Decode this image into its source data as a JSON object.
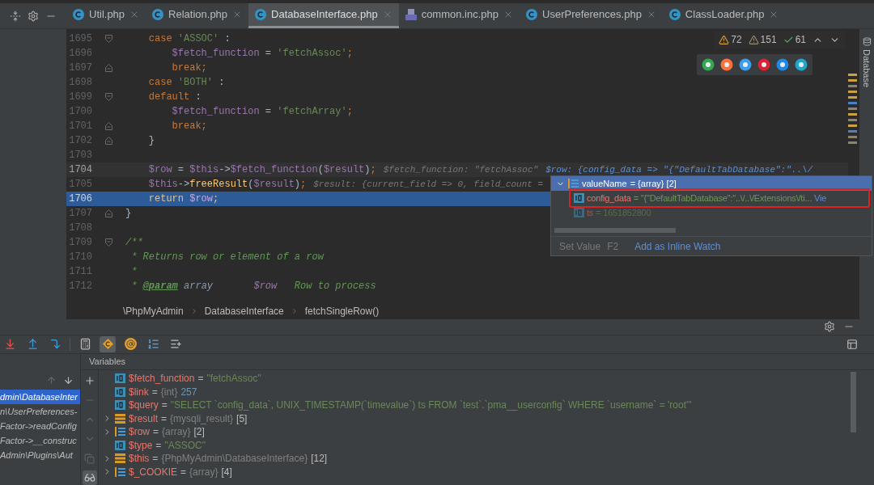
{
  "tabs": [
    {
      "label": "Util.php",
      "kind": "class",
      "selected": false
    },
    {
      "label": "Relation.php",
      "kind": "class",
      "selected": false
    },
    {
      "label": "DatabaseInterface.php",
      "kind": "class",
      "selected": true
    },
    {
      "label": "common.inc.php",
      "kind": "php",
      "selected": false
    },
    {
      "label": "UserPreferences.php",
      "kind": "class",
      "selected": false
    },
    {
      "label": "ClassLoader.php",
      "kind": "class",
      "selected": false
    }
  ],
  "inspections": [
    {
      "kind": "error",
      "count": "72"
    },
    {
      "kind": "warning",
      "count": "151"
    },
    {
      "kind": "ok",
      "count": "61"
    }
  ],
  "browsers": [
    {
      "color": "#34a853"
    },
    {
      "color": "#ff7139"
    },
    {
      "color": "#3b9cf0"
    },
    {
      "color": "#e0202e"
    },
    {
      "color": "#1e88e5"
    },
    {
      "color": "#1fa7c9"
    }
  ],
  "code_lines": [
    {
      "number": "1695",
      "kind": "fold-start",
      "current": false,
      "execution": false,
      "tokens": [
        {
          "kind": "kw",
          "text": "    case "
        },
        {
          "kind": "str",
          "text": "'ASSOC'"
        },
        {
          "kind": "plain",
          "text": " :"
        }
      ]
    },
    {
      "number": "1696",
      "kind": "plain",
      "current": false,
      "execution": false,
      "tokens": [
        {
          "kind": "var",
          "text": "        $fetch_function"
        },
        {
          "kind": "plain",
          "text": " = "
        },
        {
          "kind": "str",
          "text": "'fetchAssoc'"
        },
        {
          "kind": "kw",
          "text": ";"
        }
      ]
    },
    {
      "number": "1697",
      "kind": "fold-end",
      "current": false,
      "execution": false,
      "tokens": [
        {
          "kind": "kw",
          "text": "        break;"
        }
      ]
    },
    {
      "number": "1698",
      "kind": "plain",
      "current": false,
      "execution": false,
      "tokens": [
        {
          "kind": "kw",
          "text": "    case "
        },
        {
          "kind": "str",
          "text": "'BOTH'"
        },
        {
          "kind": "plain",
          "text": " :"
        }
      ]
    },
    {
      "number": "1699",
      "kind": "fold-start",
      "current": false,
      "execution": false,
      "tokens": [
        {
          "kind": "kw",
          "text": "    default"
        },
        {
          "kind": "plain",
          "text": " :"
        }
      ]
    },
    {
      "number": "1700",
      "kind": "plain",
      "current": false,
      "execution": false,
      "tokens": [
        {
          "kind": "var",
          "text": "        $fetch_function"
        },
        {
          "kind": "plain",
          "text": " = "
        },
        {
          "kind": "str",
          "text": "'fetchArray'"
        },
        {
          "kind": "kw",
          "text": ";"
        }
      ]
    },
    {
      "number": "1701",
      "kind": "fold-end",
      "current": false,
      "execution": false,
      "tokens": [
        {
          "kind": "kw",
          "text": "        break;"
        }
      ]
    },
    {
      "number": "1702",
      "kind": "fold-end",
      "current": false,
      "execution": false,
      "tokens": [
        {
          "kind": "plain",
          "text": "    }"
        }
      ]
    },
    {
      "number": "1703",
      "kind": "plain",
      "current": false,
      "execution": false
    },
    {
      "number": "1704",
      "kind": "plain",
      "current": true,
      "execution": false,
      "tokens": [
        {
          "kind": "var",
          "text": "    $row"
        },
        {
          "kind": "plain",
          "text": " = "
        },
        {
          "kind": "var",
          "text": "$this"
        },
        {
          "kind": "plain",
          "text": "->"
        },
        {
          "kind": "var",
          "text": "$fetch_function"
        },
        {
          "kind": "plain",
          "text": "("
        },
        {
          "kind": "var",
          "text": "$result"
        },
        {
          "kind": "plain",
          "text": ")"
        },
        {
          "kind": "kw",
          "text": ";"
        }
      ],
      "hints": [
        {
          "kind": "plain",
          "text": "$fetch_function: \"fetchAssoc\""
        },
        {
          "kind": "changed",
          "text": "$row: {config_data => \"{\"DefaultTabDatabase\":\"..\\/"
        }
      ]
    },
    {
      "number": "1705",
      "kind": "plain",
      "current": false,
      "execution": false,
      "tokens": [
        {
          "kind": "var",
          "text": "    $this"
        },
        {
          "kind": "plain",
          "text": "->"
        },
        {
          "kind": "fn",
          "text": "freeResult"
        },
        {
          "kind": "plain",
          "text": "("
        },
        {
          "kind": "var",
          "text": "$result"
        },
        {
          "kind": "plain",
          "text": ")"
        },
        {
          "kind": "kw",
          "text": ";"
        }
      ],
      "hints": [
        {
          "kind": "plain",
          "text": "$result: {current_field => 0, field_count ="
        }
      ]
    },
    {
      "number": "1706",
      "kind": "plain",
      "current": false,
      "execution": true,
      "tokens": [
        {
          "kind": "kw",
          "text": "    return "
        },
        {
          "kind": "var",
          "text": "$row"
        },
        {
          "kind": "kw",
          "text": ";"
        }
      ]
    },
    {
      "number": "1707",
      "kind": "fold-end",
      "current": false,
      "execution": false,
      "tokens": [
        {
          "kind": "plain",
          "text": "}"
        }
      ]
    },
    {
      "number": "1708",
      "kind": "plain",
      "current": false,
      "execution": false
    },
    {
      "number": "1709",
      "kind": "fold-start",
      "current": false,
      "execution": false,
      "tokens": [
        {
          "kind": "comment",
          "text": "/**"
        }
      ]
    },
    {
      "number": "1710",
      "kind": "plain",
      "current": false,
      "execution": false,
      "tokens": [
        {
          "kind": "comment",
          "text": " * Returns row or element of a row"
        }
      ]
    },
    {
      "number": "1711",
      "kind": "plain",
      "current": false,
      "execution": false,
      "tokens": [
        {
          "kind": "comment",
          "text": " *"
        }
      ]
    },
    {
      "number": "1712",
      "kind": "plain",
      "current": false,
      "execution": false,
      "tokens": [
        {
          "kind": "comment",
          "text": " * "
        },
        {
          "kind": "doctag",
          "text": "@param"
        },
        {
          "kind": "docplain",
          "text": " array       "
        },
        {
          "kind": "docvar",
          "text": "$row"
        },
        {
          "kind": "comment",
          "text": "   Row to process"
        }
      ]
    }
  ],
  "value_popup": {
    "root": {
      "name": "valueName",
      "value": "= {array} [2]",
      "expanded": true,
      "selected": true
    },
    "children": [
      {
        "name": "config_data",
        "value": "= \"{\"DefaultTabDatabase\":\"..\\/..\\/Extensions\\/ti...",
        "link": "Vie",
        "annotated": true,
        "dim": false
      },
      {
        "name": "ts",
        "value": "= 1651852800",
        "annotated": false,
        "dim": true
      }
    ],
    "actions": [
      {
        "kind": "plain",
        "label": "Set Value",
        "shortcut": "F2"
      },
      {
        "kind": "link",
        "label": "Add as Inline Watch"
      }
    ]
  },
  "breadcrumb": [
    "\\PhpMyAdmin",
    "DatabaseInterface",
    "fetchSingleRow()"
  ],
  "debug": {
    "toolbar": [
      {
        "kind": "step-into",
        "selected": false
      },
      {
        "kind": "step-out",
        "selected": false
      },
      {
        "kind": "run-to-cursor",
        "selected": false
      },
      {
        "kind": "evaluate",
        "selected": false
      },
      {
        "kind": "class-filter",
        "selected": true
      },
      {
        "kind": "at",
        "selected": false
      },
      {
        "kind": "numbered-list",
        "selected": false
      },
      {
        "kind": "add-list",
        "selected": false
      }
    ],
    "frames": [
      {
        "text": "dmin\\DatabaseInter",
        "selected": true
      },
      {
        "text": "n\\UserPreferences-",
        "selected": false
      },
      {
        "text": "Factor->readConfig",
        "selected": false
      },
      {
        "text": "Factor->__construc",
        "selected": false
      },
      {
        "text": "Admin\\Plugins\\Aut",
        "selected": false
      }
    ],
    "variables_title": "Variables",
    "side_tools": [
      {
        "kind": "add",
        "disabled": false,
        "selected": false
      },
      {
        "kind": "remove",
        "disabled": true,
        "selected": false
      },
      {
        "kind": "up",
        "disabled": true,
        "selected": false
      },
      {
        "kind": "down",
        "disabled": true,
        "selected": false
      },
      {
        "kind": "copy",
        "disabled": true,
        "selected": false
      },
      {
        "kind": "watch",
        "disabled": false,
        "selected": true
      }
    ],
    "variables": [
      {
        "kind": "primitive",
        "expandable": false,
        "name": "$fetch_function",
        "separator": "=",
        "value": {
          "kind": "string",
          "text": "\"fetchAssoc\""
        }
      },
      {
        "kind": "primitive",
        "expandable": false,
        "name": "$link",
        "separator": "=",
        "type": "{int}",
        "value": {
          "kind": "number",
          "text": "257"
        }
      },
      {
        "kind": "primitive",
        "expandable": false,
        "name": "$query",
        "separator": "=",
        "value": {
          "kind": "string",
          "text": "\"SELECT `config_data`, UNIX_TIMESTAMP(`timevalue`) ts FROM `test`.`pma__userconfig` WHERE `username` = 'root'\""
        }
      },
      {
        "kind": "object",
        "expandable": true,
        "name": "$result",
        "separator": "=",
        "type": "{mysqli_result}",
        "value": {
          "kind": "count",
          "text": "[5]"
        }
      },
      {
        "kind": "array",
        "expandable": true,
        "name": "$row",
        "separator": "=",
        "type": "{array}",
        "value": {
          "kind": "count",
          "text": "[2]"
        }
      },
      {
        "kind": "primitive",
        "expandable": false,
        "name": "$type",
        "separator": "=",
        "value": {
          "kind": "string",
          "text": "\"ASSOC\""
        }
      },
      {
        "kind": "object",
        "expandable": true,
        "name": "$this",
        "separator": "=",
        "type": "{PhpMyAdmin\\DatabaseInterface}",
        "value": {
          "kind": "count",
          "text": "[12]"
        }
      },
      {
        "kind": "array",
        "expandable": true,
        "name": "$_COOKIE",
        "separator": "=",
        "type": "{array}",
        "value": {
          "kind": "count",
          "text": "[4]"
        }
      }
    ]
  },
  "right_sidebar": {
    "label": "Database"
  }
}
